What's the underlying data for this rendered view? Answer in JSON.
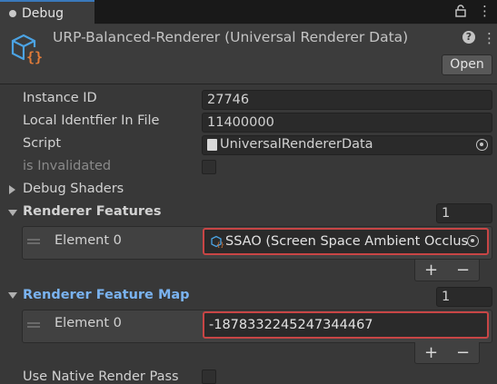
{
  "window": {
    "tab_label": "Debug"
  },
  "header": {
    "title": "URP-Balanced-Renderer (Universal Renderer Data)",
    "help_glyph": "?",
    "open_label": "Open"
  },
  "properties": {
    "instance_id_label": "Instance ID",
    "instance_id_value": "27746",
    "local_identifier_label": "Local Identfier In File",
    "local_identifier_value": "11400000",
    "script_label": "Script",
    "script_value": "UniversalRendererData",
    "invalidated_label": "is Invalidated",
    "debug_shaders_label": "Debug Shaders"
  },
  "renderer_features": {
    "label": "Renderer Features",
    "count": "1",
    "element_label": "Element 0",
    "element_value": "SSAO (Screen Space Ambient Occlus"
  },
  "renderer_feature_map": {
    "label": "Renderer Feature Map",
    "count": "1",
    "element_label": "Element 0",
    "element_value": "-1878332245247344467"
  },
  "list_controls": {
    "add": "+",
    "remove": "−"
  },
  "bottom": {
    "native_render_pass_label": "Use Native Render Pass"
  },
  "colors": {
    "accent_blue": "#7ab3f0",
    "highlight_red": "#c84545",
    "panel_bg": "#383838"
  }
}
